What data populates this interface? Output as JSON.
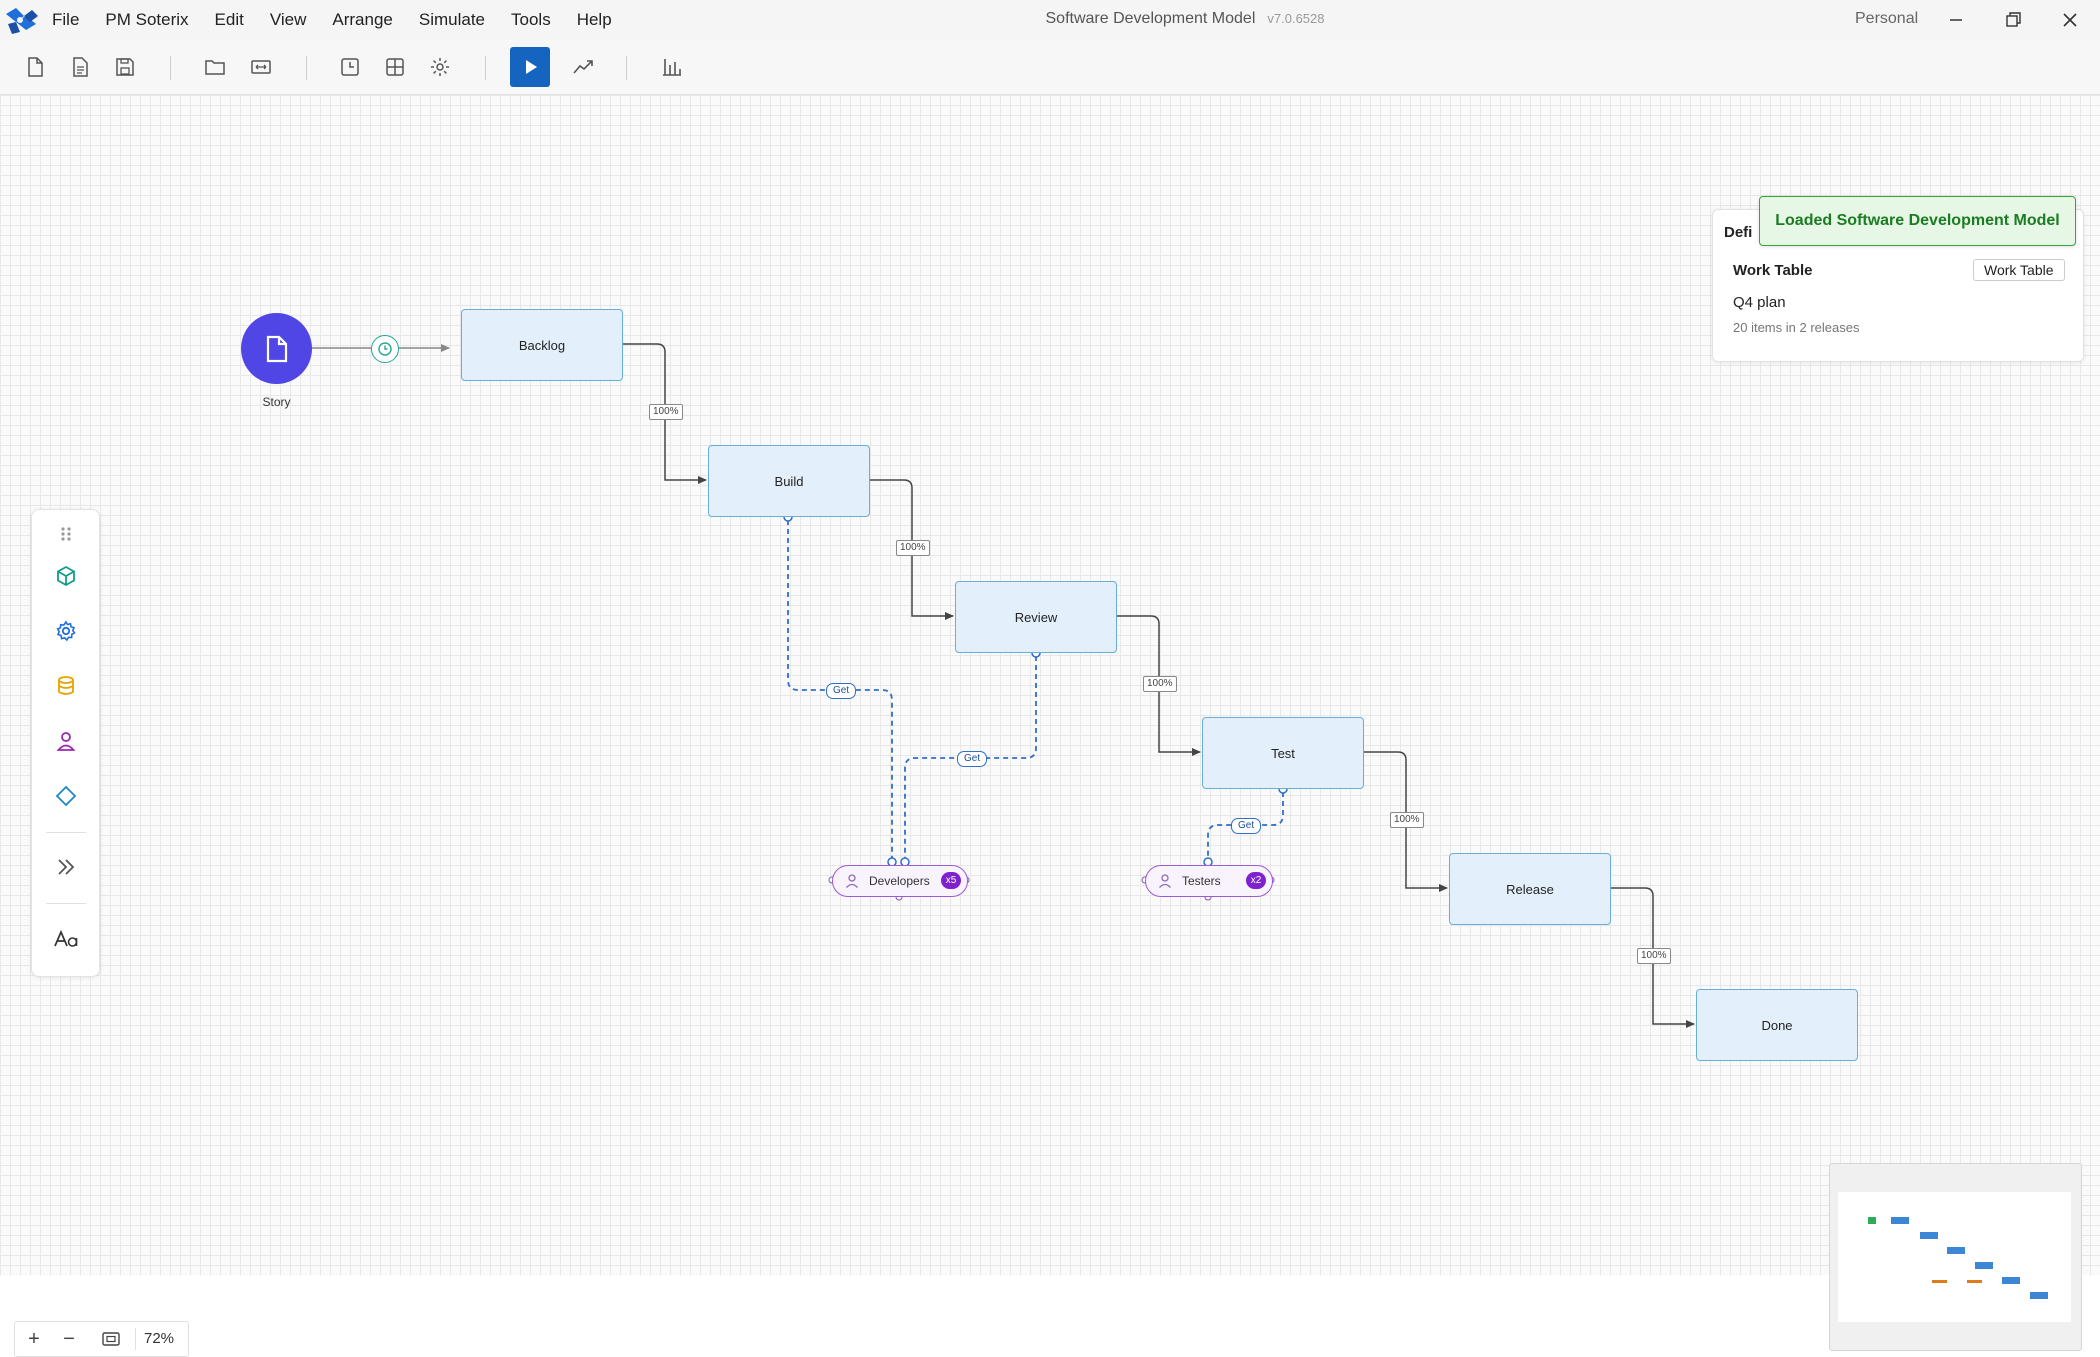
{
  "app": {
    "name": "PM Soterix",
    "document_title": "Software Development Model",
    "version": "v7.0.6528",
    "account": "Personal"
  },
  "menu": [
    "File",
    "PM Soterix",
    "Edit",
    "View",
    "Arrange",
    "Simulate",
    "Tools",
    "Help"
  ],
  "toolbar": {
    "icons": [
      "new-file-icon",
      "page-icon",
      "save-icon",
      "open-folder-icon",
      "resize-icon",
      "clock-icon",
      "grid-icon",
      "settings-icon",
      "play-icon",
      "trend-icon",
      "bar-chart-icon"
    ]
  },
  "diagram": {
    "start": {
      "label": "Story",
      "icon": "document-icon"
    },
    "timer_icon": "clock-icon",
    "activities": [
      "Backlog",
      "Build",
      "Review",
      "Test",
      "Release",
      "Done"
    ],
    "transition_labels": [
      "100%",
      "100%",
      "100%",
      "100%",
      "100%"
    ],
    "get_labels": [
      "Get",
      "Get",
      "Get"
    ],
    "resources": [
      {
        "name": "Developers",
        "count": "x5"
      },
      {
        "name": "Testers",
        "count": "x2"
      }
    ]
  },
  "palette": {
    "items": [
      "drag-handle-icon",
      "cube-icon",
      "gear-icon",
      "database-icon",
      "person-icon",
      "diamond-icon",
      "double-chevron-icon",
      "text-style-icon"
    ]
  },
  "definitions": {
    "title": "Defi",
    "work_table_label": "Work Table",
    "work_table_button": "Work Table",
    "plan": "Q4 plan",
    "items_summary": "20 items in 2 releases"
  },
  "toast": {
    "message": "Loaded Software Development Model"
  },
  "zoom": {
    "plus": "+",
    "minus": "−",
    "value": "72%"
  },
  "colors": {
    "accent": "#1565c0",
    "start_event": "#4f46e5",
    "activity_fill": "#e3f0fb",
    "activity_border": "#6aaed6",
    "resource": "#7e22ce",
    "toast_green": "#1c7c23"
  }
}
